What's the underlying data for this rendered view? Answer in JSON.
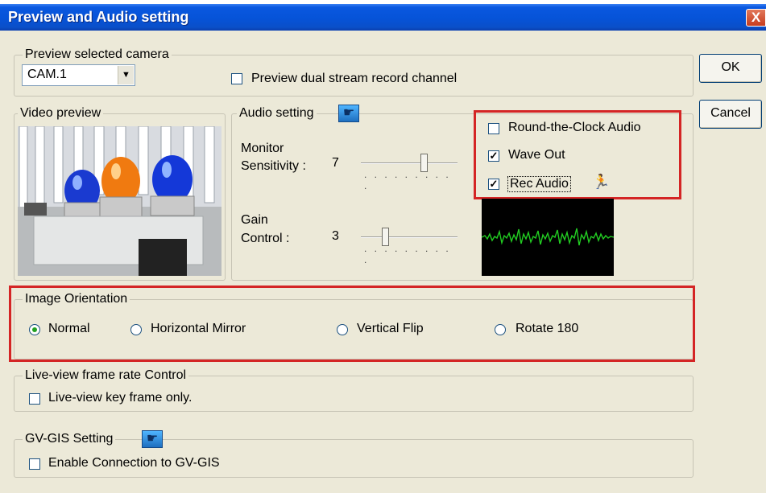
{
  "window": {
    "title": "Preview and Audio setting",
    "close_label": "X"
  },
  "buttons": {
    "ok": "OK",
    "cancel": "Cancel"
  },
  "preview_camera": {
    "legend": "Preview selected camera",
    "camera_value": "CAM.1",
    "dual_stream_label": "Preview dual stream record channel",
    "dual_stream_checked": false
  },
  "video_preview": {
    "legend": "Video preview"
  },
  "audio": {
    "legend": "Audio setting",
    "monitor_label_1": "Monitor",
    "monitor_label_2": "Sensitivity :",
    "monitor_value": "7",
    "monitor_level": 0.72,
    "gain_label_1": "Gain",
    "gain_label_2": "Control :",
    "gain_value": "3",
    "gain_level": 0.3,
    "round_clock_label": "Round-the-Clock Audio",
    "round_clock_checked": false,
    "wave_out_label": "Wave Out",
    "wave_out_checked": true,
    "rec_audio_label": "Rec Audio",
    "rec_audio_checked": true,
    "check_mark": "✓",
    "person_icon": "🏃",
    "pointer_icon": "☛"
  },
  "orientation": {
    "legend": "Image Orientation",
    "normal": "Normal",
    "horizontal": "Horizontal Mirror",
    "vertical": "Vertical Flip",
    "rotate": "Rotate 180",
    "selected": "Normal"
  },
  "liveview": {
    "legend": "Live-view frame rate Control",
    "key_frame_label": "Live-view key frame only.",
    "key_frame_checked": false
  },
  "gis": {
    "legend": "GV-GIS Setting",
    "enable_label": "Enable Connection to GV-GIS",
    "enable_checked": false,
    "pointer_icon": "☛"
  },
  "colors": {
    "highlight": "#d42525",
    "title_blue": "#0653d8",
    "waveform": "#22cc22"
  }
}
